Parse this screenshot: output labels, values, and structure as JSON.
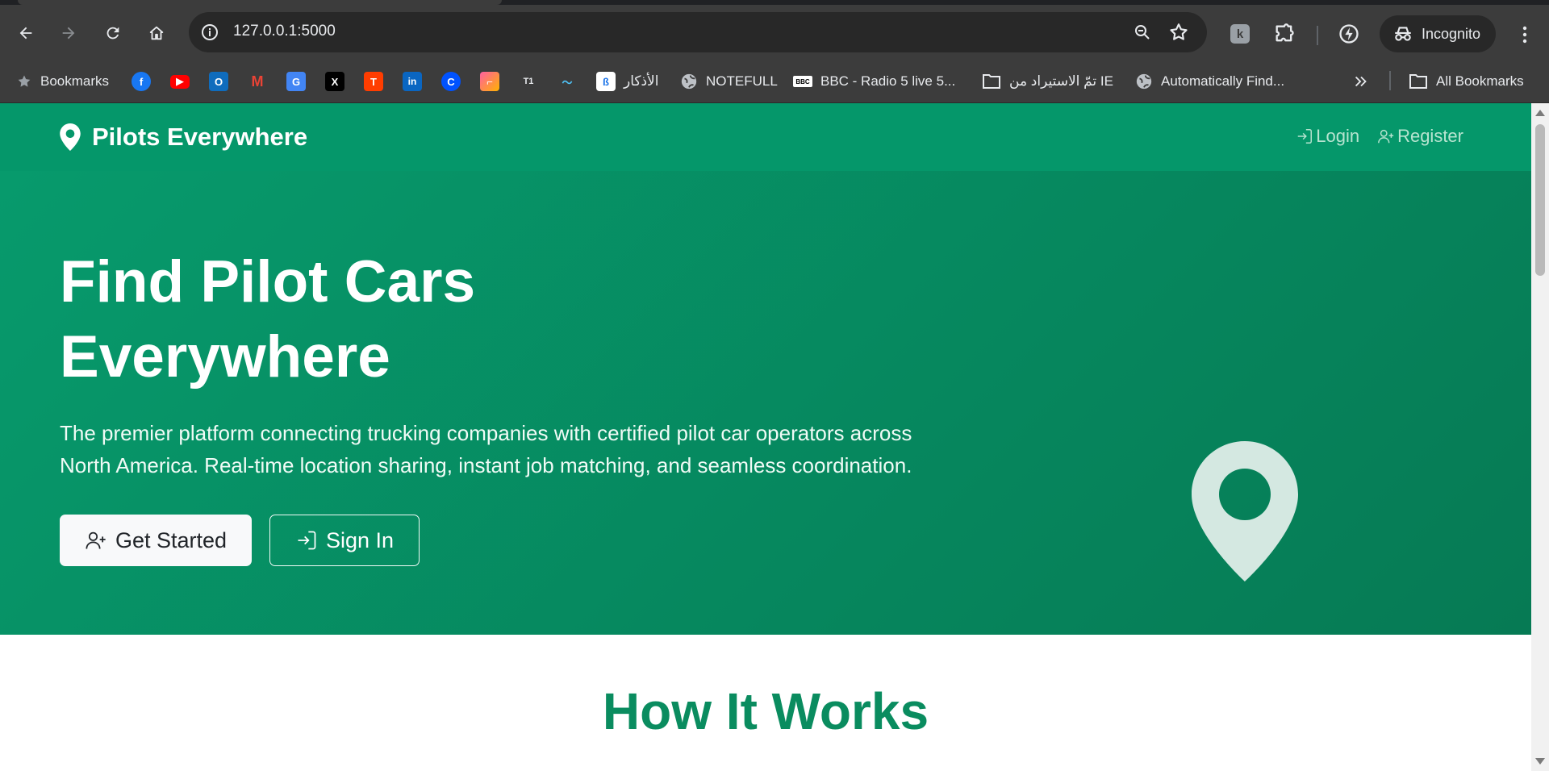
{
  "browser": {
    "url": "127.0.0.1:5000",
    "profile_label": "Incognito",
    "extension_letter": "k"
  },
  "bookmarks_bar": {
    "bookmarks_label": "Bookmarks",
    "items": [
      {
        "icon": "facebook-icon",
        "label": ""
      },
      {
        "icon": "youtube-icon",
        "label": ""
      },
      {
        "icon": "outlook-icon",
        "label": ""
      },
      {
        "icon": "gmail-icon",
        "label": ""
      },
      {
        "icon": "google-translate-icon",
        "label": ""
      },
      {
        "icon": "x-icon",
        "label": ""
      },
      {
        "icon": "t-app-icon",
        "label": ""
      },
      {
        "icon": "linkedin-icon",
        "label": ""
      },
      {
        "icon": "c-app-icon",
        "label": ""
      },
      {
        "icon": "stairs-app-icon",
        "label": ""
      },
      {
        "icon": "t1-app-icon",
        "label": ""
      },
      {
        "icon": "waves-icon",
        "label": ""
      }
    ],
    "adhkar_label": "الأذكار",
    "notefull_label": "NOTEFULL",
    "bbc_label": "BBC - Radio 5 live 5...",
    "folder_label": "تمّ الاستيراد من IE",
    "auto_label": "Automatically Find...",
    "all_bookmarks_label": "All Bookmarks"
  },
  "site": {
    "brand": "Pilots Everywhere",
    "nav": {
      "login": "Login",
      "register": "Register"
    },
    "hero": {
      "title_line1": "Find Pilot Cars",
      "title_line2": "Everywhere",
      "subtitle_line1": "The premier platform connecting trucking companies with certified pilot car operators across",
      "subtitle_line2": "North America. Real-time location sharing, instant job matching, and seamless coordination.",
      "cta_primary": "Get Started",
      "cta_secondary": "Sign In"
    },
    "how_it_works_title": "How It Works"
  },
  "colors": {
    "brand_green": "#05976a",
    "hero_gradient_start": "#079a6c",
    "hero_gradient_end": "#067a54",
    "heading_green": "#0a8c5f"
  }
}
